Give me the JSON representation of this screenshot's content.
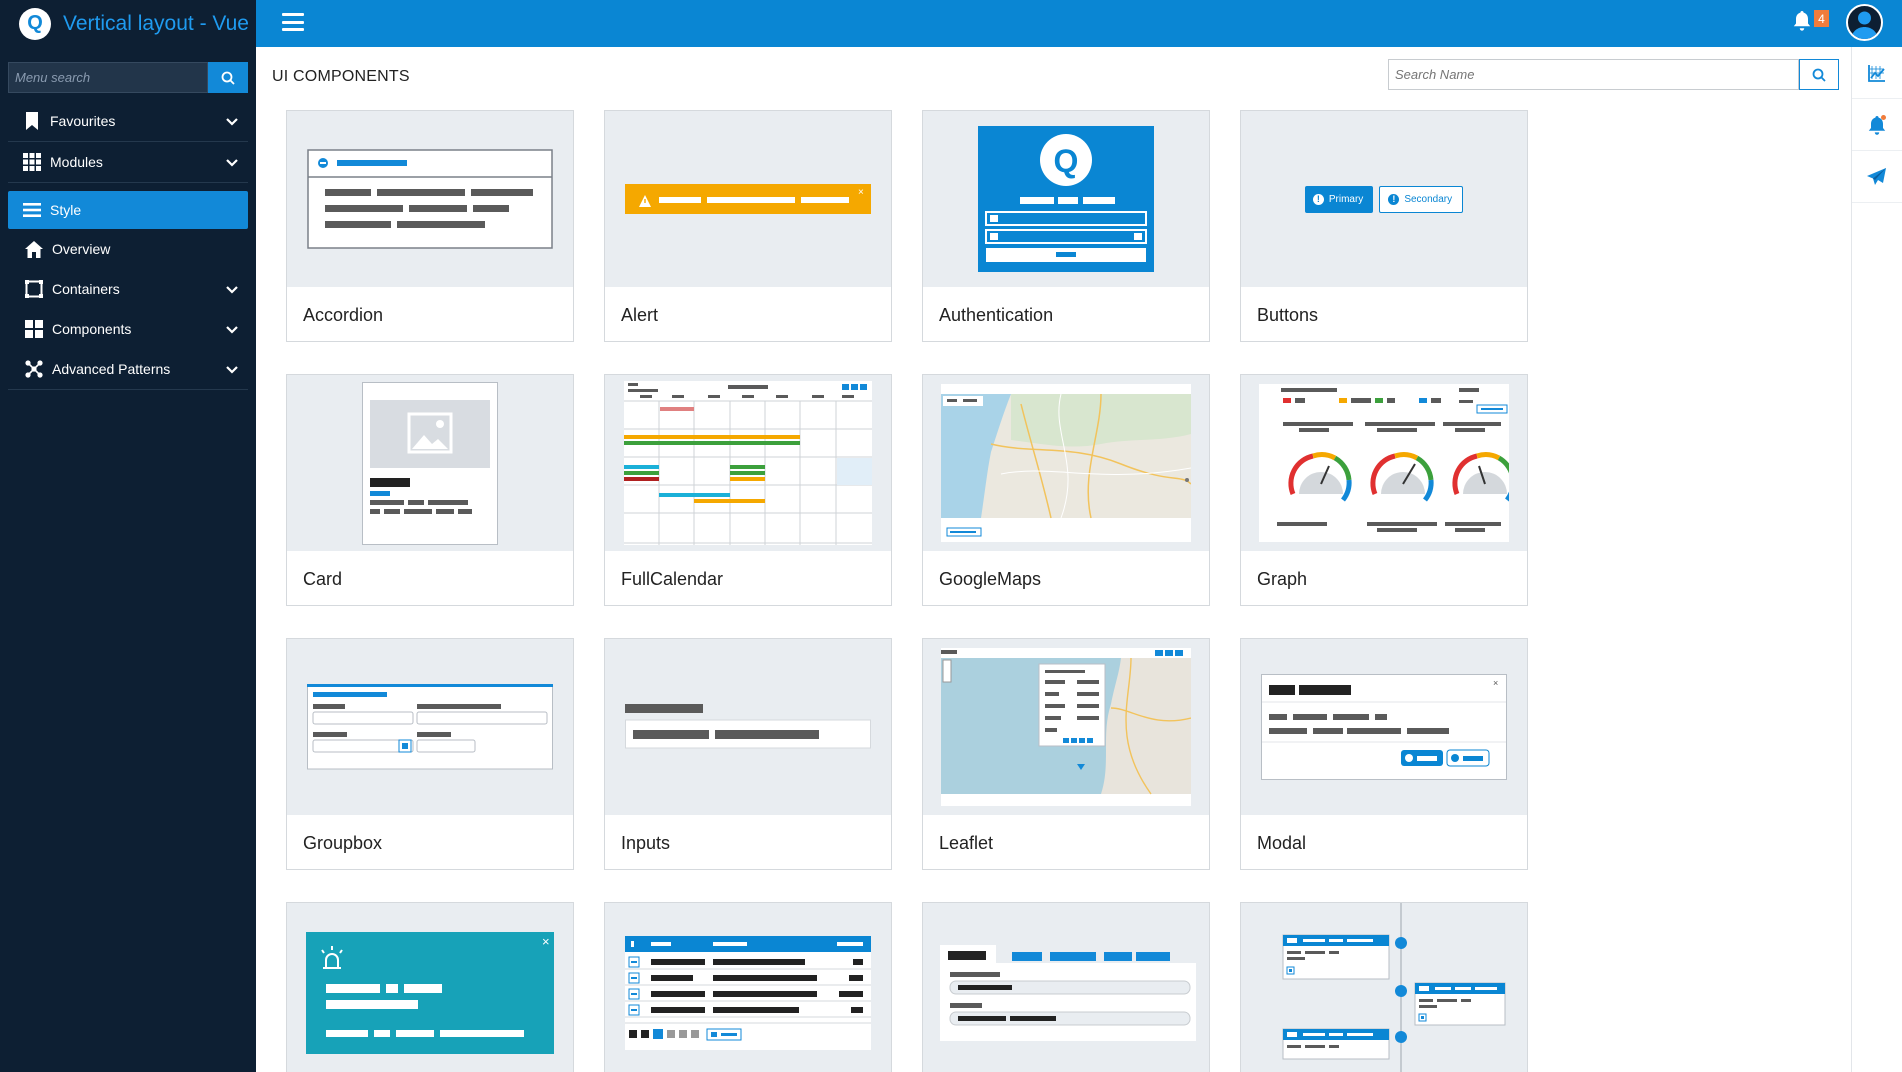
{
  "app": {
    "title": "Vertical layout - Vue",
    "logo_letter": "Q"
  },
  "sidebar": {
    "search_placeholder": "Menu search",
    "items": [
      {
        "label": "Favourites",
        "icon": "bookmark-icon",
        "has_chevron": true
      },
      {
        "label": "Modules",
        "icon": "grid-icon",
        "has_chevron": true
      },
      {
        "label": "Style",
        "icon": "list-icon",
        "active": true
      },
      {
        "label": "Overview",
        "icon": "home-icon"
      },
      {
        "label": "Containers",
        "icon": "square-icon",
        "has_chevron": true
      },
      {
        "label": "Components",
        "icon": "tiles-icon",
        "has_chevron": true
      },
      {
        "label": "Advanced Patterns",
        "icon": "nodes-icon",
        "has_chevron": true
      }
    ]
  },
  "topbar": {
    "notification_count": "4"
  },
  "main": {
    "title": "UI COMPONENTS",
    "search_placeholder": "Search Name",
    "components": [
      "Accordion",
      "Alert",
      "Authentication",
      "Buttons",
      "Card",
      "FullCalendar",
      "GoogleMaps",
      "Graph",
      "Groupbox",
      "Inputs",
      "Leaflet",
      "Modal",
      "",
      "",
      "",
      ""
    ],
    "buttons_preview": {
      "primary": "Primary",
      "secondary": "Secondary"
    }
  },
  "colors": {
    "primary": "#0a86d3",
    "sidebar": "#0d1f33",
    "alert": "#f5a800",
    "notify_badge": "#f07c3c",
    "teal": "#17a2b8"
  }
}
